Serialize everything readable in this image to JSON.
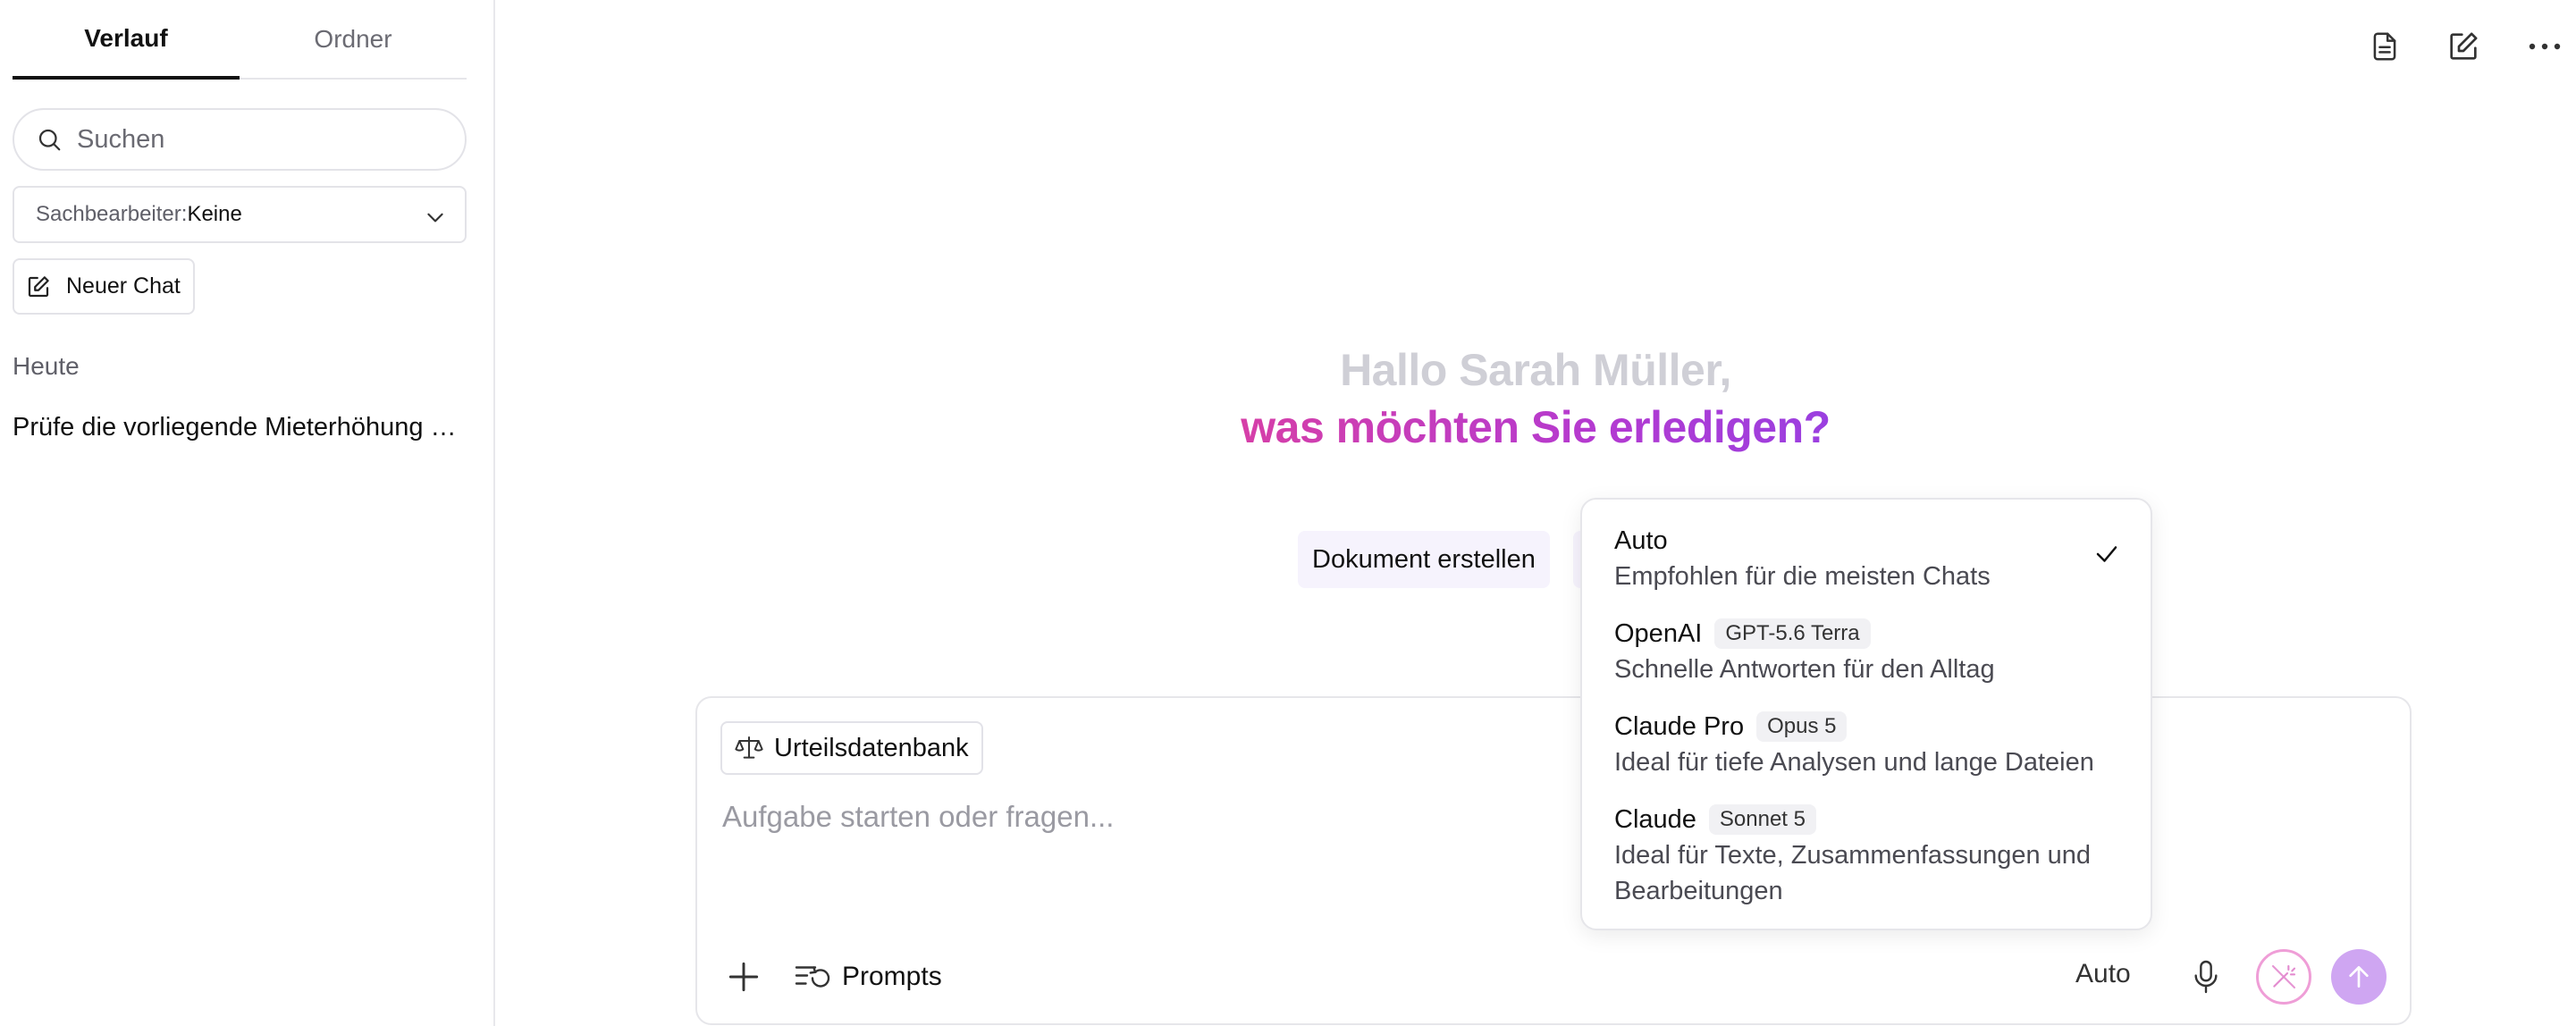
{
  "sidebar": {
    "tabs": [
      {
        "label": "Verlauf",
        "active": true
      },
      {
        "label": "Ordner",
        "active": false
      }
    ],
    "search": {
      "placeholder": "Suchen",
      "value": ""
    },
    "assignee_filter": {
      "label": "Sachbearbeiter:",
      "value": "Keine"
    },
    "new_chat_label": "Neuer Chat",
    "section_today": "Heute",
    "history": [
      {
        "title": "Prüfe die vorliegende Mieterhöhung auf Wirksamkeit"
      }
    ]
  },
  "top_icons": [
    "document-icon",
    "edit-icon",
    "more-icon"
  ],
  "greeting": {
    "line1": "Hallo Sarah Müller,",
    "line2": "was möchten Sie erledigen?"
  },
  "suggestions": [
    {
      "label": "Dokument erstellen"
    }
  ],
  "composer": {
    "pill_label": "Urteilsdatenbank",
    "placeholder": "Aufgabe starten oder fragen...",
    "prompts_label": "Prompts",
    "mode_label": "Auto"
  },
  "model_dropdown": {
    "selected": "Auto",
    "options": [
      {
        "name": "Auto",
        "badge": "",
        "description": "Empfohlen für die meisten Chats",
        "selected": true
      },
      {
        "name": "OpenAI",
        "badge": "GPT-5.6 Terra",
        "description": "Schnelle Antworten für den Alltag",
        "selected": false
      },
      {
        "name": "Claude Pro",
        "badge": "Opus 5",
        "description": "Ideal für tiefe Analysen und lange Dateien",
        "selected": false
      },
      {
        "name": "Claude",
        "badge": "Sonnet 5",
        "description": "Ideal für Texte, Zusammenfassungen und Bearbeitungen",
        "selected": false
      }
    ]
  },
  "colors": {
    "accent_gradient_start": "#d63fa8",
    "accent_gradient_end": "#9a3fe0",
    "send_button": "#cfa6f2",
    "chip_bg": "#f6f3fd"
  }
}
